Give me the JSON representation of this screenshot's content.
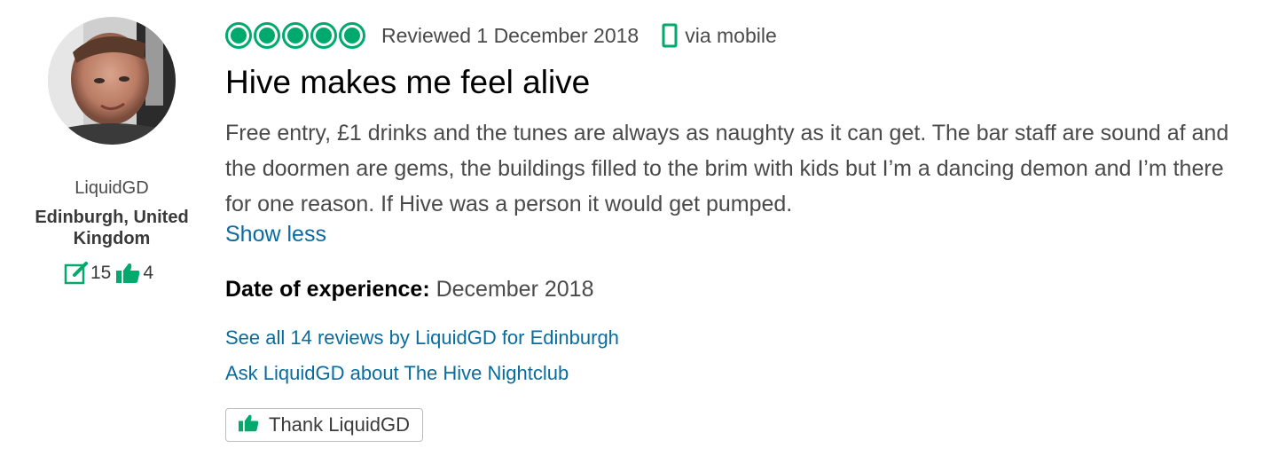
{
  "member": {
    "name": "LiquidGD",
    "location": "Edinburgh, United Kingdom",
    "reviews_count": "15",
    "helpful_votes": "4",
    "review_icon": "review-pencil-icon",
    "helpful_icon": "thumbs-up-icon"
  },
  "review": {
    "rating": 5,
    "rating_max": 5,
    "date_text": "Reviewed 1 December 2018",
    "device_text": "via mobile",
    "title": "Hive makes me feel alive",
    "text": "Free entry, £1 drinks and the tunes are always as naughty as it can get. The bar staff are sound af and the doormen are gems, the buildings filled to the brim with kids but I’m a dancing demon and I’m there for one reason. If Hive was a person it would get pumped.",
    "show_less_label": "Show less",
    "experience_label": "Date of experience:",
    "experience_value": "December 2018"
  },
  "links": {
    "see_all": "See all 14 reviews by LiquidGD for Edinburgh",
    "ask": "Ask LiquidGD about The Hive Nightclub"
  },
  "actions": {
    "thank_label": "Thank LiquidGD"
  },
  "colors": {
    "brand_green": "#00aa6c",
    "link_blue": "#0a6b9e",
    "text_gray": "#4a4a4a"
  }
}
